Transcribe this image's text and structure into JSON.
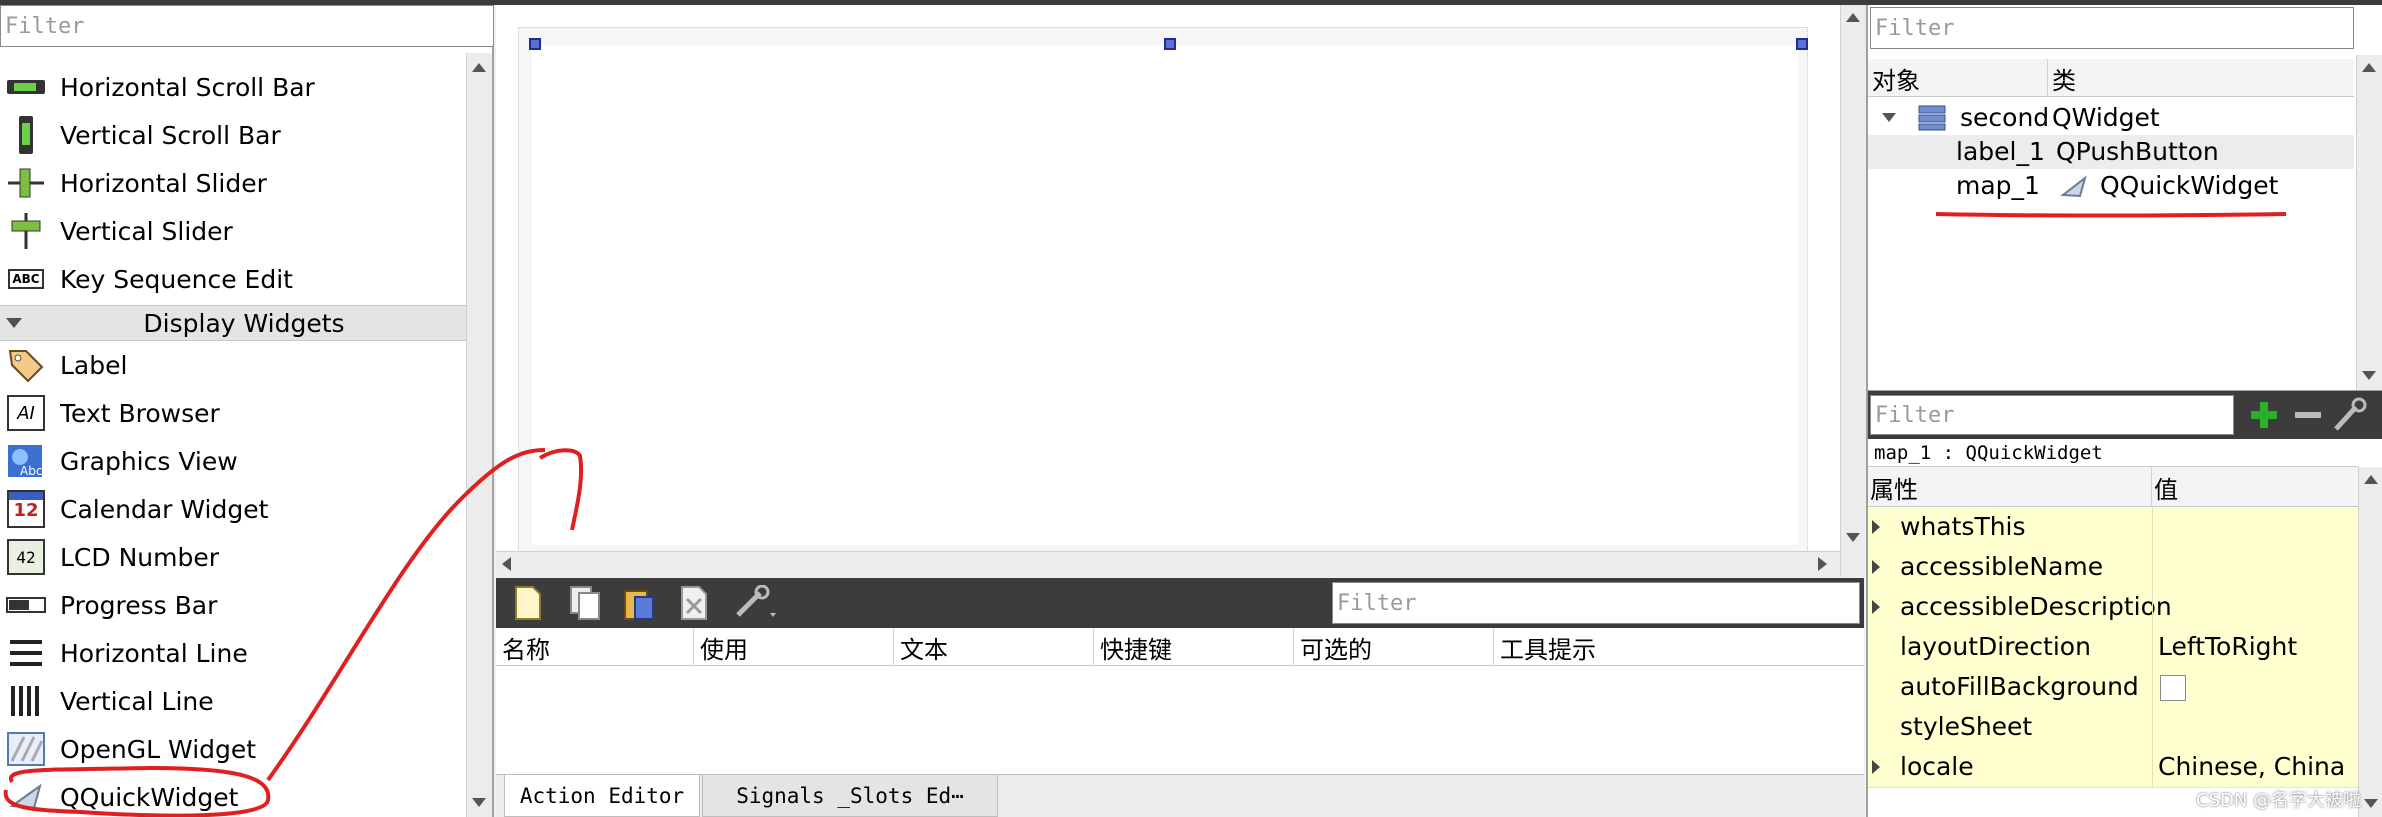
{
  "widget_box": {
    "filter_placeholder": "Filter",
    "items_top": [
      {
        "label": "Horizontal Scroll Bar",
        "icon": "horizontal-scrollbar-icon"
      },
      {
        "label": "Vertical Scroll Bar",
        "icon": "vertical-scrollbar-icon"
      },
      {
        "label": "Horizontal Slider",
        "icon": "horizontal-slider-icon"
      },
      {
        "label": "Vertical Slider",
        "icon": "vertical-slider-icon"
      },
      {
        "label": "Key Sequence Edit",
        "icon": "key-sequence-icon"
      }
    ],
    "category": "Display Widgets",
    "items_display": [
      {
        "label": "Label",
        "icon": "label-tag-icon"
      },
      {
        "label": "Text Browser",
        "icon": "text-browser-icon"
      },
      {
        "label": "Graphics View",
        "icon": "graphics-view-icon"
      },
      {
        "label": "Calendar Widget",
        "icon": "calendar-icon"
      },
      {
        "label": "LCD Number",
        "icon": "lcd-number-icon"
      },
      {
        "label": "Progress Bar",
        "icon": "progress-bar-icon"
      },
      {
        "label": "Horizontal Line",
        "icon": "horizontal-line-icon"
      },
      {
        "label": "Vertical Line",
        "icon": "vertical-line-icon"
      },
      {
        "label": "OpenGL Widget",
        "icon": "opengl-icon"
      },
      {
        "label": "QQuickWidget",
        "icon": "quick-widget-icon"
      }
    ],
    "key_sequence_glyph": "ABC",
    "calendar_glyph": "12",
    "lcd_glyph": "42",
    "text_browser_glyph": "AI"
  },
  "action_editor": {
    "filter_placeholder": "Filter",
    "columns": [
      "名称",
      "使用",
      "文本",
      "快捷键",
      "可选的",
      "工具提示"
    ],
    "tabs": [
      "Action Editor",
      "Signals _Slots Ed⋯"
    ]
  },
  "object_inspector": {
    "filter_placeholder": "Filter",
    "columns": [
      "对象",
      "类"
    ],
    "rows": [
      {
        "object": "second",
        "class": "QWidget"
      },
      {
        "object": "label_1",
        "class": "QPushButton"
      },
      {
        "object": "map_1",
        "class": "QQuickWidget"
      }
    ]
  },
  "property_editor": {
    "filter_placeholder": "Filter",
    "context": "map_1 : QQuickWidget",
    "columns": [
      "属性",
      "值"
    ],
    "rows": [
      {
        "name": "whatsThis",
        "value": ""
      },
      {
        "name": "accessibleName",
        "value": ""
      },
      {
        "name": "accessibleDescription",
        "value": ""
      },
      {
        "name": "layoutDirection",
        "value": "LeftToRight"
      },
      {
        "name": "autoFillBackground",
        "value": ""
      },
      {
        "name": "styleSheet",
        "value": ""
      },
      {
        "name": "locale",
        "value": "Chinese, China"
      }
    ]
  },
  "watermark": "CSDN @名字大被啦",
  "colors": {
    "toolbar_dark": "#3c3c3c",
    "property_row": "#ffffcf",
    "annotation_red": "#e02020",
    "add_green": "#2bb02b"
  }
}
